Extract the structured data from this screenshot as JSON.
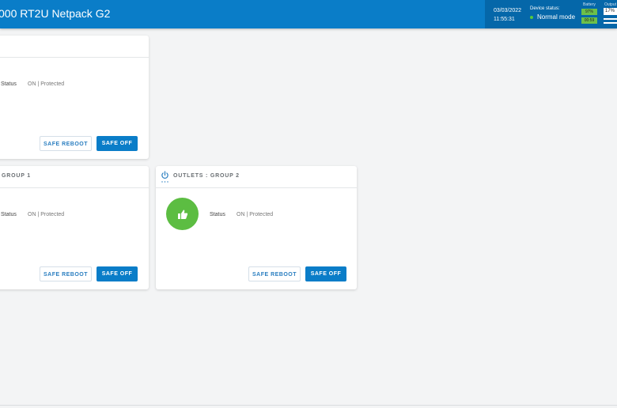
{
  "header": {
    "title": "000 RT2U Netpack G2",
    "date": "03/03/2022",
    "time": "11:55:31",
    "device_status_label": "Device status:",
    "device_mode": "Normal mode",
    "battery_label": "Battery",
    "battery_percent": "97%",
    "battery_time": "00:59",
    "output_label": "Output",
    "output_percent": "17%",
    "colors": {
      "header": "#0a7dc8",
      "panel": "#0567a9",
      "ok": "#6cc04a"
    }
  },
  "cards": [
    {
      "title": "",
      "status_label": "Status",
      "status_value": "ON | Protected",
      "reboot_label": "SAFE REBOOT",
      "off_label": "SAFE OFF"
    },
    {
      "title": "GROUP 1",
      "status_label": "Status",
      "status_value": "ON | Protected",
      "reboot_label": "SAFE REBOOT",
      "off_label": "SAFE OFF"
    },
    {
      "title": "OUTLETS : GROUP 2",
      "icon": "power-icon",
      "status_icon": "thumbs-up-icon",
      "status_label": "Status",
      "status_value": "ON | Protected",
      "reboot_label": "SAFE REBOOT",
      "off_label": "SAFE OFF"
    }
  ]
}
